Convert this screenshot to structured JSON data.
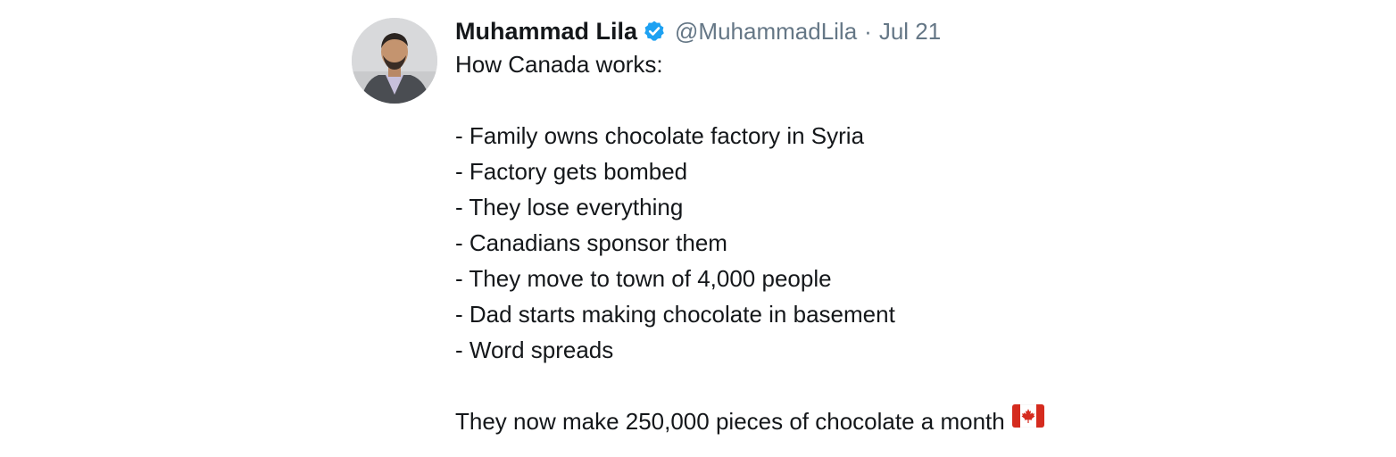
{
  "tweet": {
    "author_name": "Muhammad Lila",
    "handle": "@MuhammadLila",
    "separator": "·",
    "date": "Jul 21",
    "verified_icon": "verified-badge-icon",
    "verified_color": "#1da1f2",
    "intro": "How Canada works:",
    "bullets": [
      "- Family owns chocolate factory in Syria",
      "- Factory gets bombed",
      "- They lose everything",
      "- Canadians sponsor them",
      "- They move to town of 4,000 people",
      "- Dad starts making chocolate in basement",
      "- Word spreads"
    ],
    "conclusion": "They now make 250,000 pieces of chocolate a month",
    "flag_icon": "canada-flag-icon"
  },
  "colors": {
    "text": "#14171a",
    "secondary": "#657786",
    "flag_red": "#d52b1e"
  }
}
